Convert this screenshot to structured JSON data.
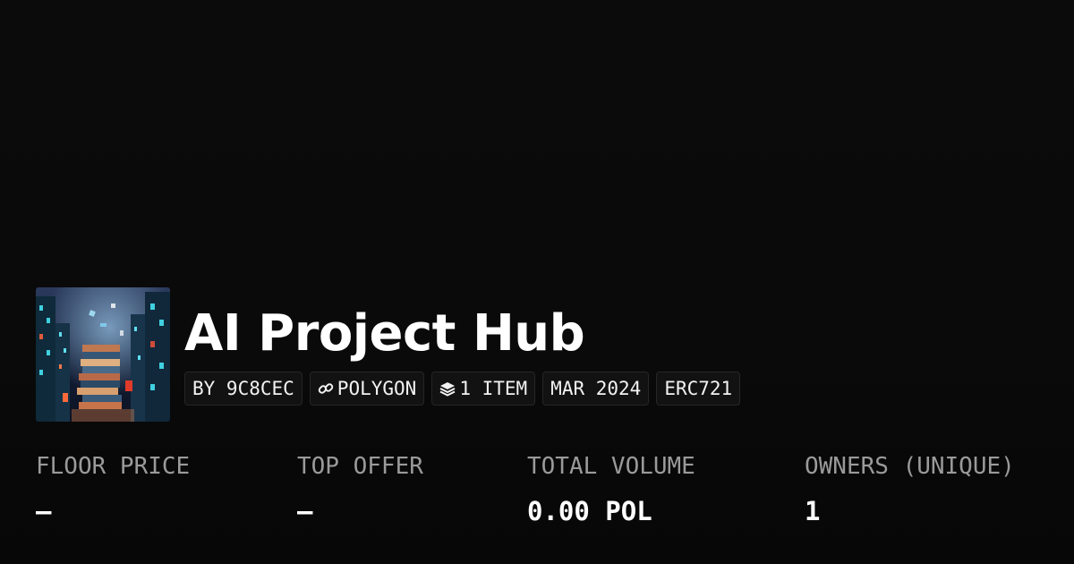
{
  "collection": {
    "title": "AI Project Hub",
    "thumbnail_icon": "collection-artwork"
  },
  "badges": [
    {
      "label": "BY 9C8CEC",
      "icon": null
    },
    {
      "label": "POLYGON",
      "icon": "link-icon"
    },
    {
      "label": "1 ITEM",
      "icon": "layers-icon"
    },
    {
      "label": "MAR 2024",
      "icon": null
    },
    {
      "label": "ERC721",
      "icon": null
    }
  ],
  "stats": [
    {
      "label": "FLOOR PRICE",
      "value": "–"
    },
    {
      "label": "TOP OFFER",
      "value": "–"
    },
    {
      "label": "TOTAL VOLUME",
      "value": "0.00 POL"
    },
    {
      "label": "OWNERS (UNIQUE)",
      "value": "1"
    }
  ],
  "colors": {
    "background": "#0a0a0a",
    "text": "#ffffff",
    "label": "#9a9a9a",
    "badge_bg": "#121212",
    "badge_border": "#262626"
  }
}
